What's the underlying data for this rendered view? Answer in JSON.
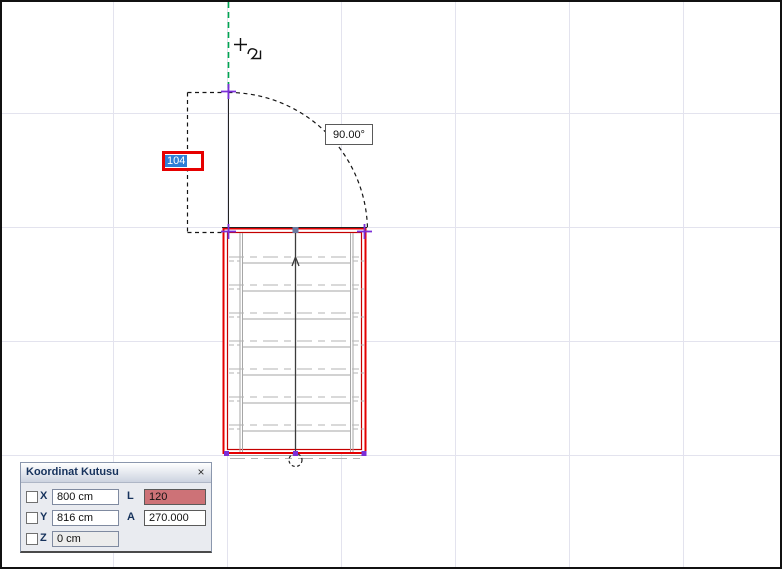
{
  "canvas": {
    "angle_label": "90.00°",
    "dim_input_value": "104"
  },
  "coordinate_panel": {
    "title": "Koordinat Kutusu",
    "close_label": "×",
    "rows": [
      {
        "axis": "X",
        "value": "800 cm",
        "param": "L",
        "param_value": "120"
      },
      {
        "axis": "Y",
        "value": "816 cm",
        "param": "A",
        "param_value": "270.000"
      },
      {
        "axis": "Z",
        "value": "0 cm"
      }
    ]
  },
  "colors": {
    "accent-red": "#e60000",
    "selection-blue": "#2e7fd6",
    "salmon": "#cd7277",
    "marker-purple": "#7b2fd8",
    "guide-green": "#00a651",
    "grid-line": "#e3e3ee",
    "navy": "#16325c"
  }
}
